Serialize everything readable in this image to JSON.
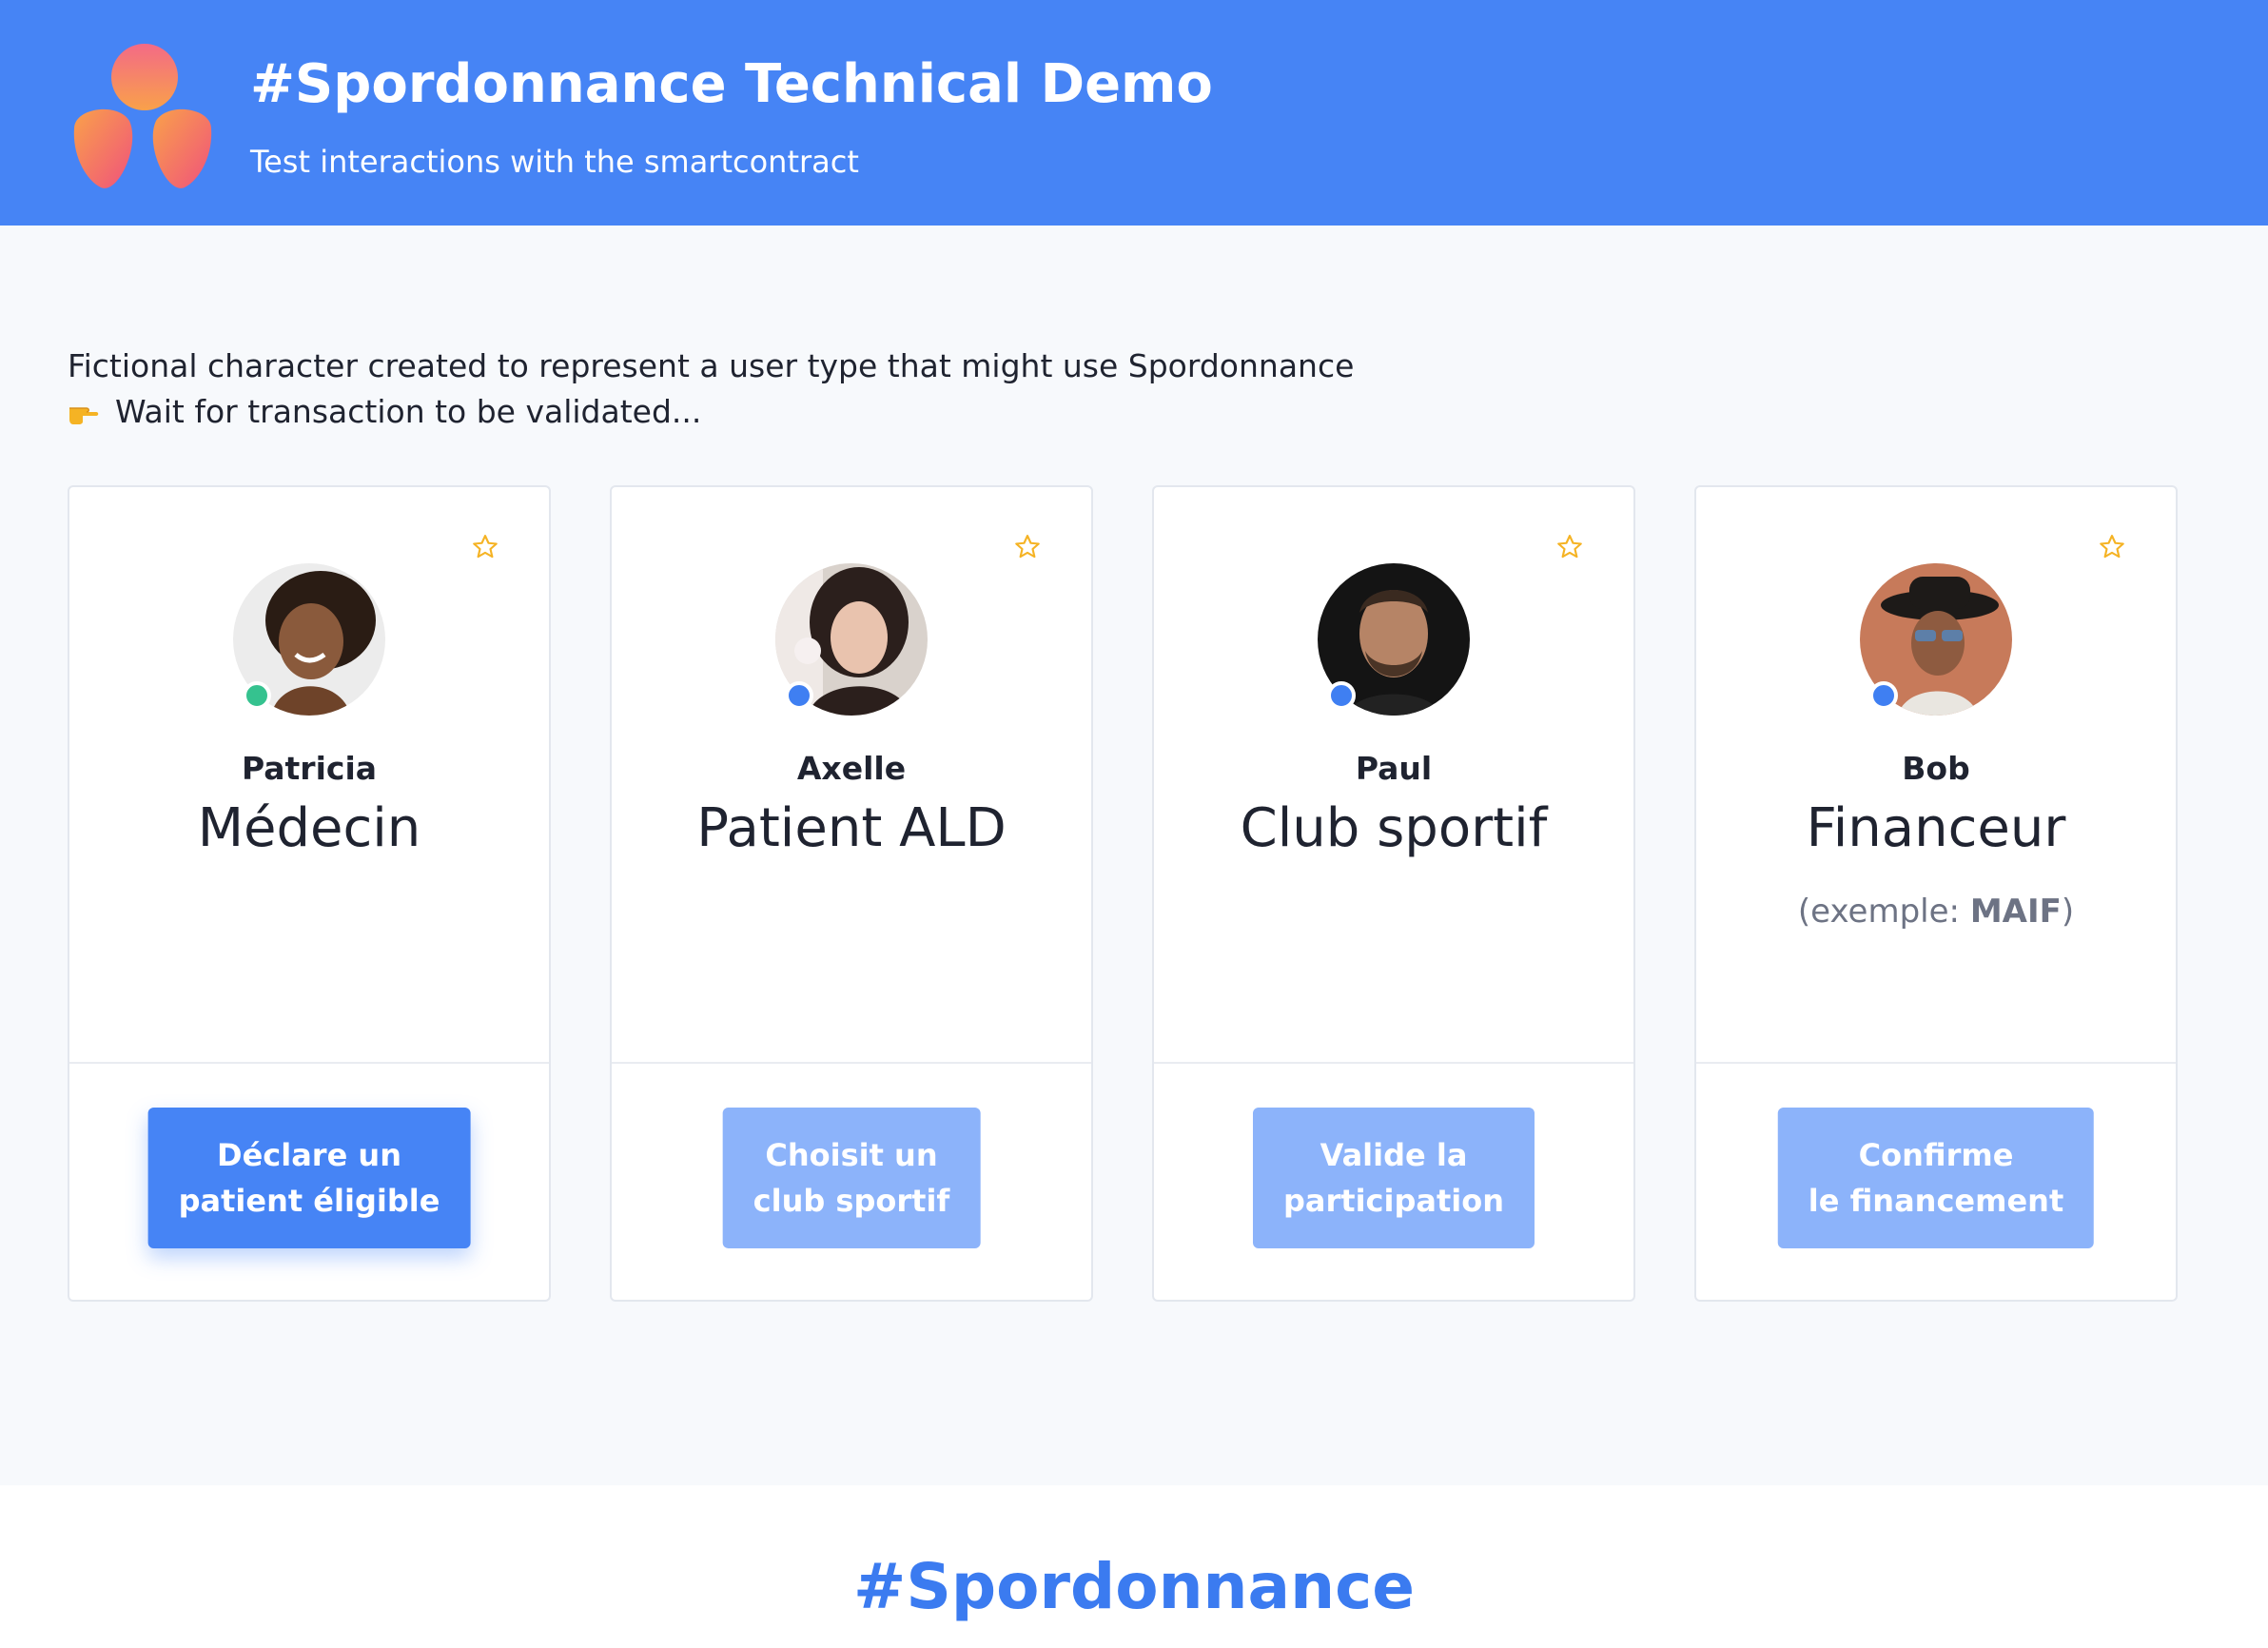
{
  "header": {
    "title": "#Spordonnance Technical Demo",
    "subtitle": "Test interactions with the smartcontract",
    "logo_icon": "three-petal-logo-icon"
  },
  "intro": {
    "description": "Fictional character created to represent a user type that might use Spordonnance",
    "status_icon": "pointing-hand-icon",
    "status": "Wait for transaction to be validated..."
  },
  "cards": [
    {
      "name": "Patricia",
      "role": "Médecin",
      "note_prefix": "",
      "note_bold": "",
      "note_suffix": "",
      "status_color": "#35c28f",
      "button_line1": "Déclare un",
      "button_line2": "patient éligible",
      "button_state": "active"
    },
    {
      "name": "Axelle",
      "role": "Patient ALD",
      "note_prefix": "",
      "note_bold": "",
      "note_suffix": "",
      "status_color": "#3f7ff2",
      "button_line1": "Choisit un",
      "button_line2": "club sportif",
      "button_state": "disabled"
    },
    {
      "name": "Paul",
      "role": "Club sportif",
      "note_prefix": "",
      "note_bold": "",
      "note_suffix": "",
      "status_color": "#3f7ff2",
      "button_line1": "Valide la",
      "button_line2": "participation",
      "button_state": "disabled"
    },
    {
      "name": "Bob",
      "role": "Financeur",
      "note_prefix": "(exemple: ",
      "note_bold": "MAIF",
      "note_suffix": ")",
      "status_color": "#3f7ff2",
      "button_line1": "Confirme",
      "button_line2": "le financement",
      "button_state": "disabled"
    }
  ],
  "footer": {
    "title": "#Spordonnance"
  },
  "colors": {
    "brand_blue": "#4684f5",
    "button_disabled": "#8cb3fa",
    "star": "#f5b324",
    "online": "#35c28f"
  }
}
